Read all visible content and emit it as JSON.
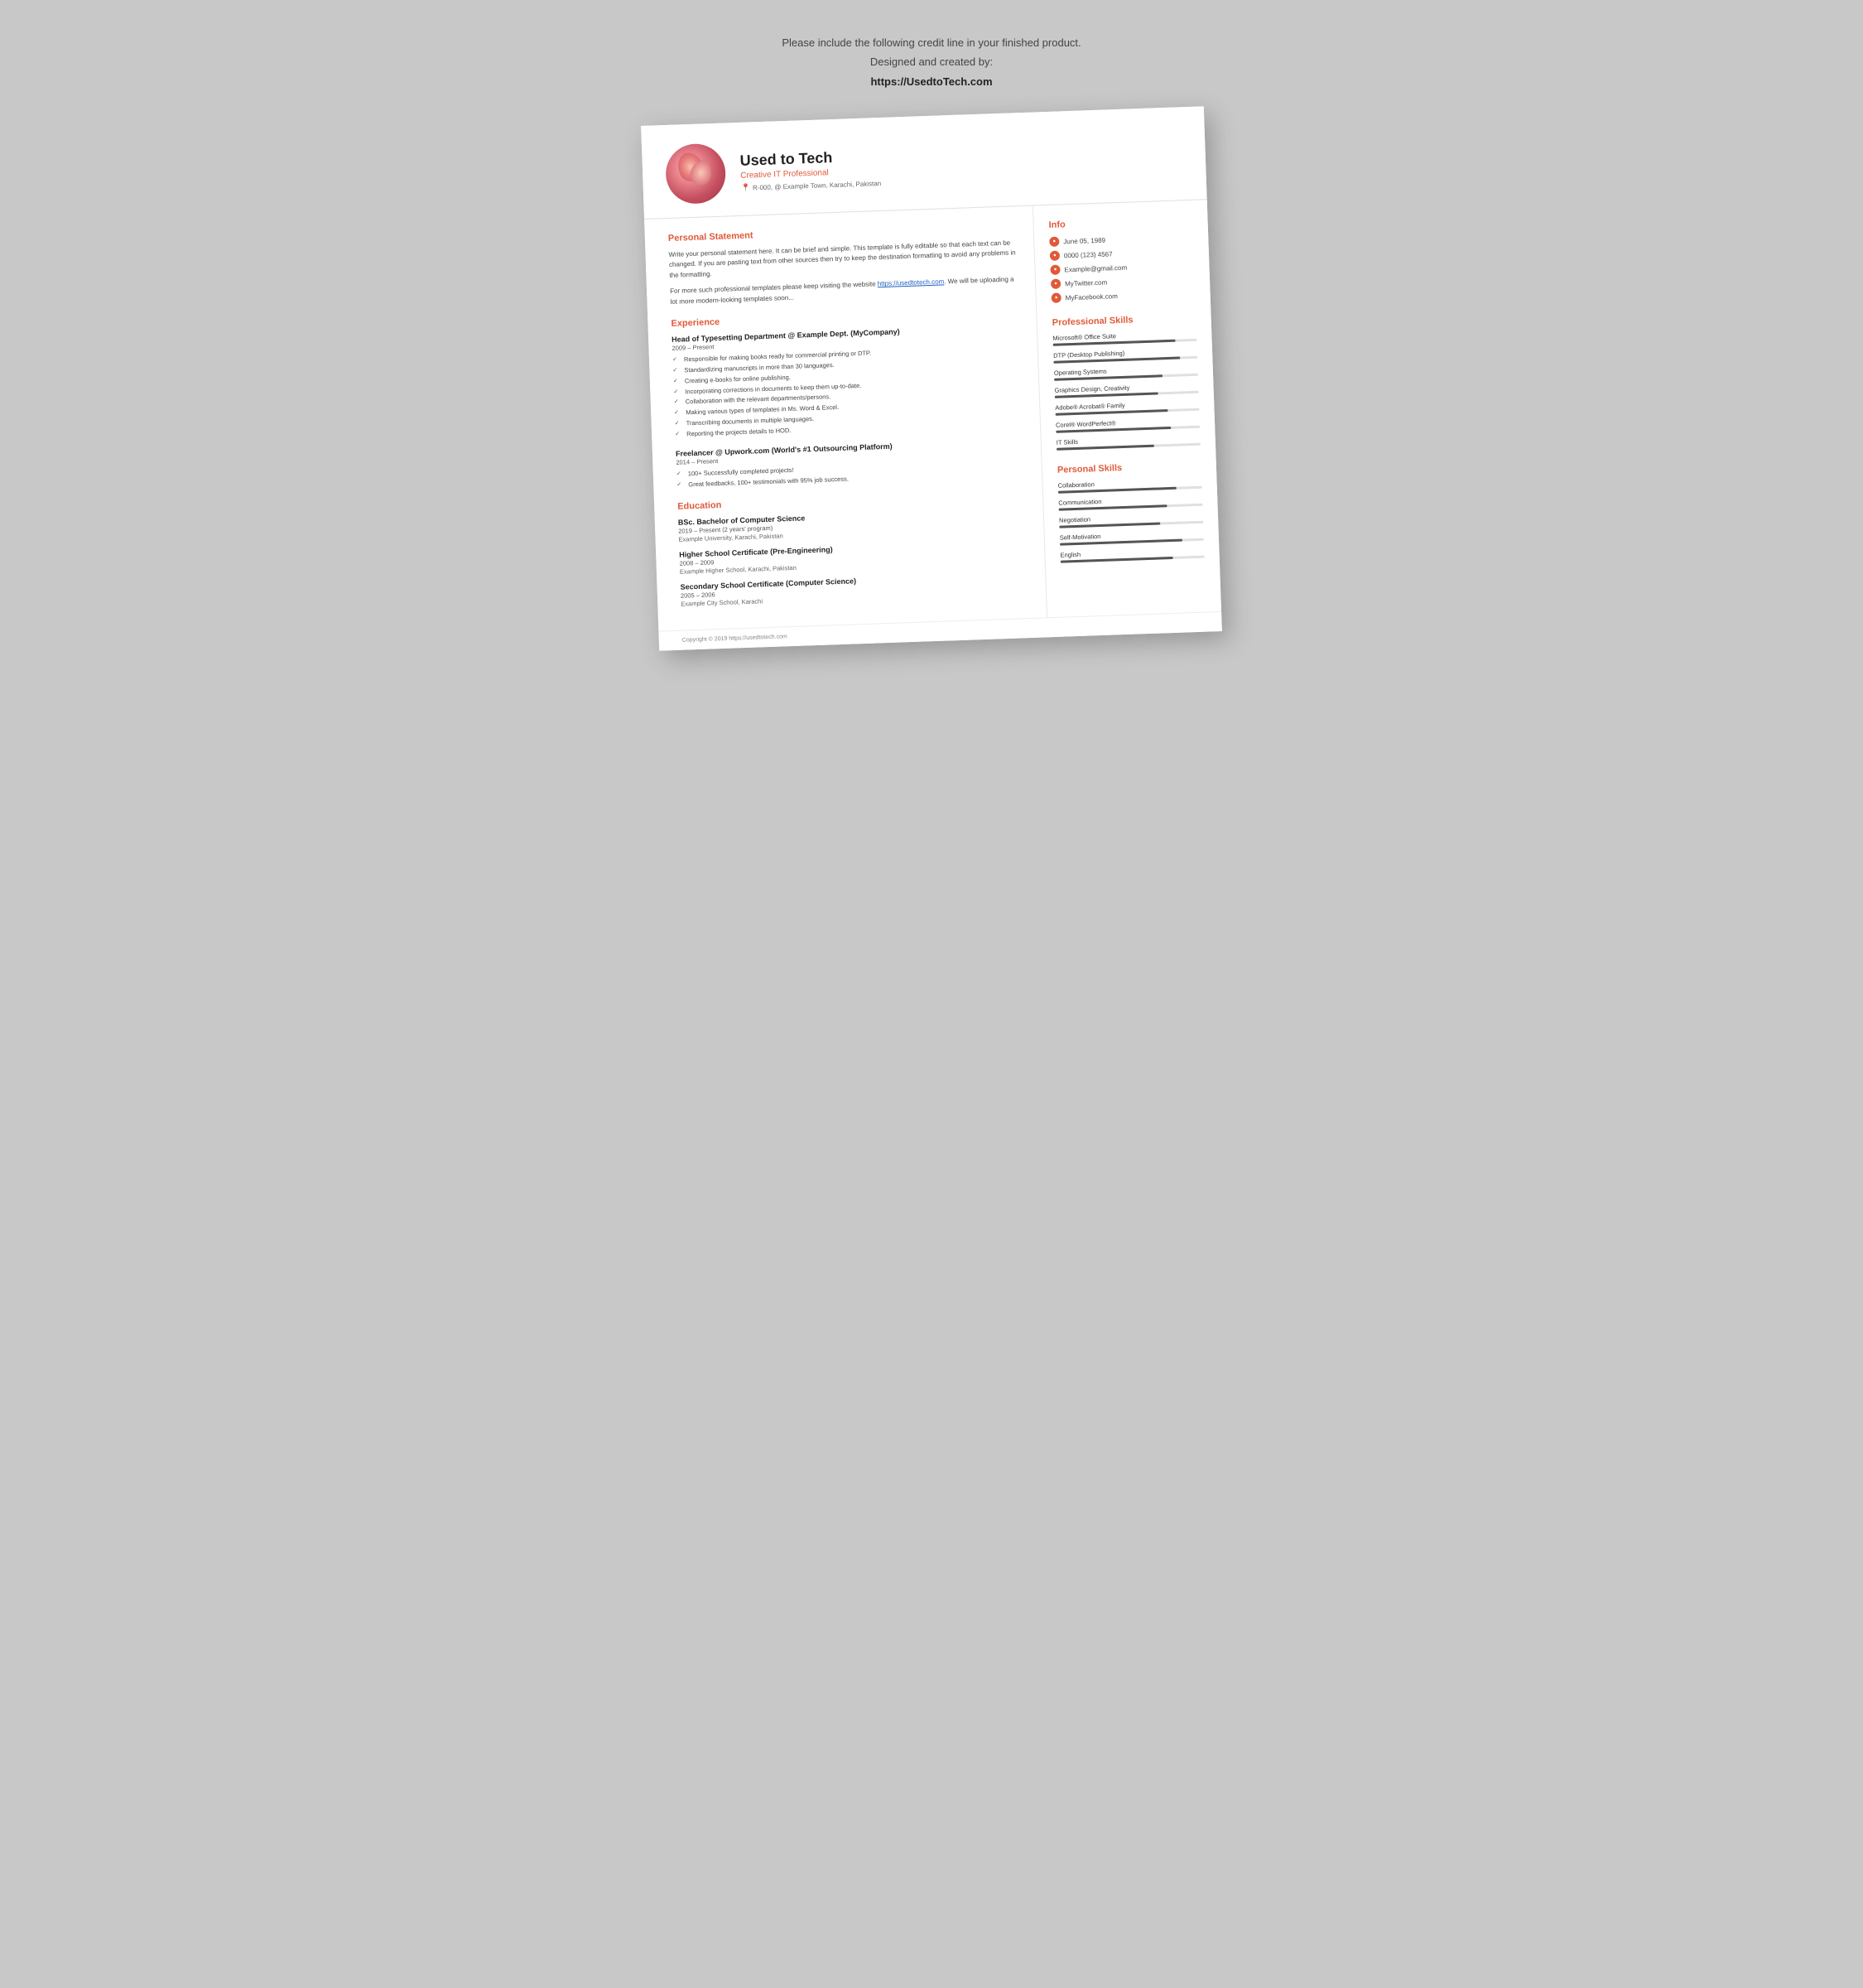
{
  "credit": {
    "line1": "Please include the following credit line in your finished product.",
    "line2": "Designed and created by:",
    "line3": "https://UsedtoTech.com"
  },
  "header": {
    "name": "Used to Tech",
    "subtitle": "Creative IT Professional",
    "address": "R-000, @ Example Town, Karachi, Pakistan"
  },
  "personal_statement": {
    "title": "Personal Statement",
    "para1": "Write your personal statement here. It can be brief and simple. This template is fully editable so that each text can be changed. If you are pasting text from other sources then try to keep the destination formatting to avoid any problems in the formatting.",
    "para2": "For more such professional templates please keep visiting the website https://usedtotech.com. We will be uploading a lot more modern-looking templates soon..."
  },
  "experience": {
    "title": "Experience",
    "jobs": [
      {
        "title": "Head of Typesetting Department @ Example Dept. (MyCompany)",
        "dates": "2009 – Present",
        "bullets": [
          "Responsible for making books ready for commercial printing or DTP.",
          "Standardizing manuscripts in more than 30 languages.",
          "Creating e-books for online publishing.",
          "Incorporating corrections in documents to keep them up-to-date.",
          "Collaboration with the relevant departments/persons.",
          "Making various types of templates in Ms. Word & Excel.",
          "Transcribing documents in multiple languages.",
          "Reporting the projects details to HOD."
        ]
      },
      {
        "title": "Freelancer @ Upwork.com (World's #1 Outsourcing Platform)",
        "dates": "2014 – Present",
        "bullets": [
          "100+ Successfully completed projects!",
          "Great feedbacks, 100+ testimonials with 95% job success."
        ]
      }
    ]
  },
  "education": {
    "title": "Education",
    "entries": [
      {
        "degree": "BSc. Bachelor of Computer Science",
        "dates": "2019 – Present (2 years' program)",
        "school": "Example University, Karachi, Pakistan"
      },
      {
        "degree": "Higher School Certificate (Pre-Engineering)",
        "dates": "2008 – 2009",
        "school": "Example Higher School, Karachi, Pakistan"
      },
      {
        "degree": "Secondary School Certificate (Computer Science)",
        "dates": "2005 – 2006",
        "school": "Example City School, Karachi"
      }
    ]
  },
  "info": {
    "title": "Info",
    "items": [
      {
        "icon": "📅",
        "text": "June 05, 1989"
      },
      {
        "icon": "📞",
        "text": "0000 (123) 4567"
      },
      {
        "icon": "✉",
        "text": "Example@gmail.com"
      },
      {
        "icon": "🐦",
        "text": "MyTwitter.com"
      },
      {
        "icon": "f",
        "text": "MyFacebook.com"
      }
    ]
  },
  "professional_skills": {
    "title": "Professional Skills",
    "skills": [
      {
        "name": "Microsoft® Office Suite",
        "percent": 85
      },
      {
        "name": "DTP (Desktop Publishing)",
        "percent": 88
      },
      {
        "name": "Operating Systems",
        "percent": 75
      },
      {
        "name": "Graphics Design, Creativity",
        "percent": 72
      },
      {
        "name": "Adobe® Acrobat® Family",
        "percent": 78
      },
      {
        "name": "Corel® WordPerfect®",
        "percent": 80
      },
      {
        "name": "IT Skills",
        "percent": 68
      }
    ]
  },
  "personal_skills": {
    "title": "Personal Skills",
    "skills": [
      {
        "name": "Collaboration",
        "percent": 82
      },
      {
        "name": "Communication",
        "percent": 75
      },
      {
        "name": "Negotiation",
        "percent": 70
      },
      {
        "name": "Self-Motivation",
        "percent": 85
      },
      {
        "name": "English",
        "percent": 78
      }
    ]
  },
  "footer": {
    "text": "Copyright © 2019 https://usedtotech.com"
  }
}
